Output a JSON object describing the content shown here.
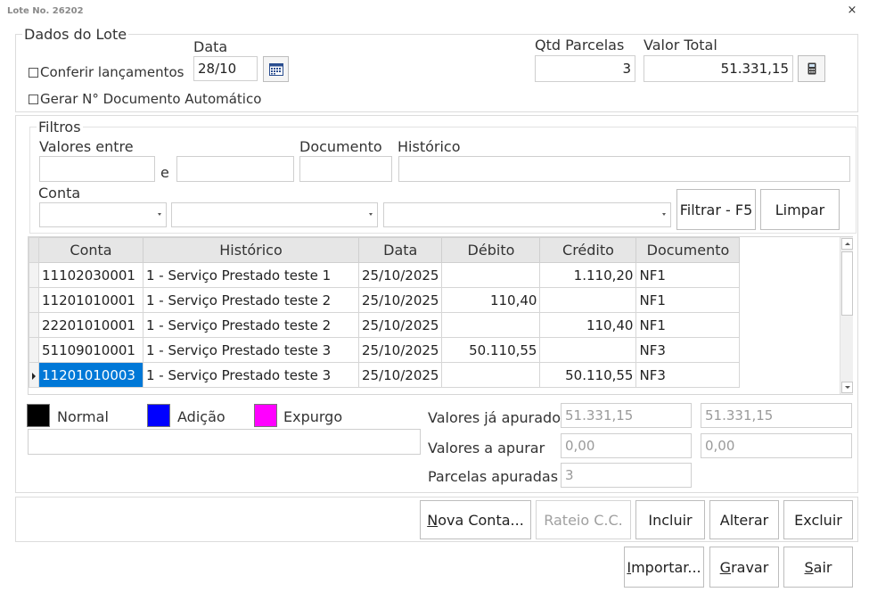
{
  "window": {
    "title": "Lote No. 26202",
    "close_glyph": "×"
  },
  "dados_lote": {
    "legend": "Dados do Lote",
    "data_label": "Data",
    "data_value": "28/10",
    "conferir_label": "Conferir lançamentos",
    "gerar_label": "Gerar N° Documento Automático",
    "qtd_label": "Qtd Parcelas",
    "qtd_value": "3",
    "valor_total_label": "Valor Total",
    "valor_total_value": "51.331,15"
  },
  "filtros": {
    "legend": "Filtros",
    "valores_label": "Valores entre",
    "e_label": "e",
    "documento_label": "Documento",
    "historico_label": "Histórico",
    "conta_label": "Conta",
    "filtrar_label": "Filtrar - F5",
    "limpar_label": "Limpar"
  },
  "grid": {
    "columns": [
      "Conta",
      "Histórico",
      "Data",
      "Débito",
      "Crédito",
      "Documento"
    ],
    "rows": [
      {
        "conta": "11102030001",
        "historico": "1 - Serviço Prestado teste 1",
        "data": "25/10/2025",
        "debito": "",
        "credito": "1.110,20",
        "documento": "NF1"
      },
      {
        "conta": "11201010001",
        "historico": "1 - Serviço Prestado teste 2",
        "data": "25/10/2025",
        "debito": "110,40",
        "credito": "",
        "documento": "NF1"
      },
      {
        "conta": "22201010001",
        "historico": "1 - Serviço Prestado teste 2",
        "data": "25/10/2025",
        "debito": "",
        "credito": "110,40",
        "documento": "NF1"
      },
      {
        "conta": "51109010001",
        "historico": "1 - Serviço Prestado teste 3",
        "data": "25/10/2025",
        "debito": "50.110,55",
        "credito": "",
        "documento": "NF3"
      },
      {
        "conta": "11201010003",
        "historico": "1 - Serviço Prestado teste 3",
        "data": "25/10/2025",
        "debito": "",
        "credito": "50.110,55",
        "documento": "NF3"
      }
    ]
  },
  "legend_colors": {
    "normal_label": "Normal",
    "normal_color": "#000000",
    "adicao_label": "Adição",
    "adicao_color": "#0000ff",
    "expurgo_label": "Expurgo",
    "expurgo_color": "#ff00ff"
  },
  "totals": {
    "ja_apurados_label": "Valores já apurados",
    "ja_apurados_1": "51.331,15",
    "ja_apurados_2": "51.331,15",
    "a_apurar_label": "Valores a apurar",
    "a_apurar_1": "0,00",
    "a_apurar_2": "0,00",
    "parcelas_label": "Parcelas apuradas",
    "parcelas_value": "3"
  },
  "actions": {
    "nova_conta_u": "N",
    "nova_conta_rest": "ova Conta...",
    "rateio": "Rateio C.C.",
    "incluir": "Incluir",
    "alterar": "Alterar",
    "excluir": "Excluir",
    "importar_u": "I",
    "importar_rest": "mportar...",
    "gravar_u": "G",
    "gravar_rest": "ravar",
    "sair_u": "S",
    "sair_rest": "air"
  },
  "icons": {
    "calendar": "calendar-icon",
    "calculator": "calculator-icon"
  },
  "accent": {
    "selection": "#0078d7"
  }
}
